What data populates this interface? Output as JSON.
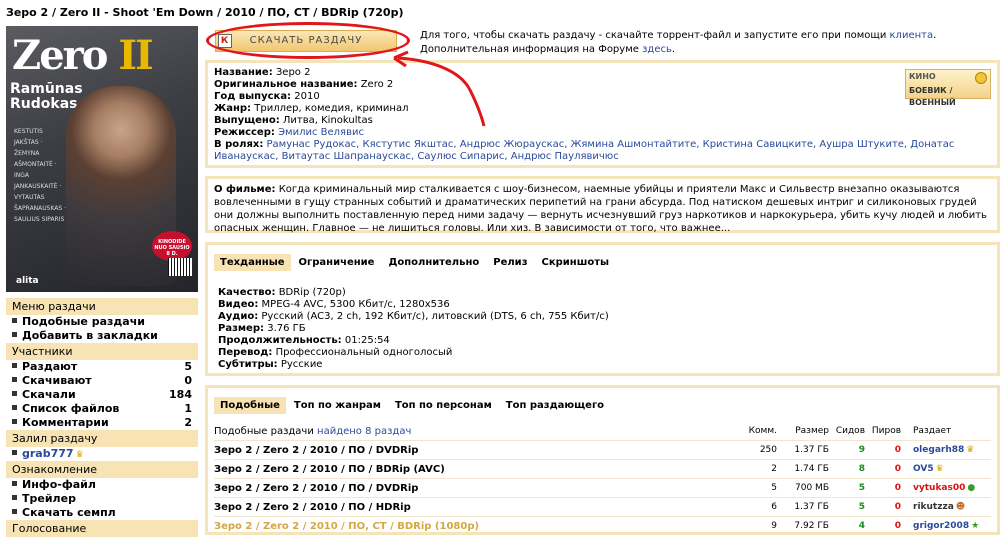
{
  "title": "Зеро 2 / Zero II - Shoot 'Em Down / 2010 / ПО, СТ / BDRip (720p)",
  "poster": {
    "logo_a": "Zero",
    "logo_b": "II",
    "actor1": "Ramūnas",
    "actor2": "Rudokas",
    "names": "KESTUTIS JAKŠTAS · ŽEMYNA AŠMONTAITĖ · INGA JANKAUSKAITĖ · VYTAUTAS ŠAPRANAUSKAS · SAULIUS SIPARIS",
    "badge": "KINODIDE NUO SAUSIO 8 D.",
    "studio": "alita"
  },
  "download": {
    "button": "СКАЧАТЬ РАЗДАЧУ",
    "text_a": "Для того, чтобы скачать раздачу - скачайте торрент-файл и запустите его при помощи",
    "client_link": "клиента",
    "text_b": ". Дополнительная информация на Форуме",
    "here_link": "здесь",
    "text_c": "."
  },
  "info": {
    "name_label": "Название:",
    "name": "Зеро 2",
    "orig_label": "Оригинальное название:",
    "orig": "Zero 2",
    "year_label": "Год выпуска:",
    "year": "2010",
    "genre_label": "Жанр:",
    "genre": "Триллер, комедия, криминал",
    "released_label": "Выпущено:",
    "released": "Литва, Kinokultas",
    "director_label": "Режиссер:",
    "director": "Эмилис Велявис",
    "cast_label": "В ролях:",
    "cast": "Рамунас Рудокас, Кястутис Якштас, Андрюс Жюраускас, Жямина Ашмонтайтите, Кристина Савицките, Аушра Штуките, Донатас Иванаускас, Витаутас Шапранаускас, Саулюс Сипарис, Андрюс Паулявичюс",
    "badge_top": "КИНО",
    "badge_genre": "БОЕВИК / ВОЕННЫЙ"
  },
  "about": {
    "label": "О фильме:",
    "text": "Когда криминальный мир сталкивается с шоу-бизнесом, наемные убийцы и приятели Макс и Сильвестр внезапно оказываются вовлеченными в гущу странных событий и драматических перипетий на грани абсурда. Под натиском дешевых интриг и силиконовых грудей они должны выполнить поставленную перед ними задачу — вернуть исчезнувший груз наркотиков и наркокурьера, убить кучу людей и любить опасных женщин. Главное — не лишиться головы. Или хиз. В зависимости от того, что важнее..."
  },
  "tabs": [
    "Техданные",
    "Ограничение",
    "Дополнительно",
    "Релиз",
    "Скриншоты"
  ],
  "tech": {
    "quality_label": "Качество:",
    "quality": "BDRip (720p)",
    "video_label": "Видео:",
    "video": "MPEG-4 AVC, 5300 Кбит/с, 1280x536",
    "audio_label": "Аудио:",
    "audio": "Русский (AC3, 2 ch, 192 Кбит/с), литовский (DTS, 6 ch, 755 Кбит/с)",
    "size_label": "Размер:",
    "size": "3.76 ГБ",
    "duration_label": "Продолжительность:",
    "duration": "01:25:54",
    "translation_label": "Перевод:",
    "translation": "Профессиональный одноголосый",
    "subs_label": "Субтитры:",
    "subs": "Русские"
  },
  "similar_tabs": [
    "Подобные",
    "Топ по жанрам",
    "Топ по персонам",
    "Топ раздающего"
  ],
  "similar": {
    "head_title": "Подобные раздачи",
    "found": "найдено 8 раздач",
    "col_comments": "Комм.",
    "col_size": "Размер",
    "col_seeds": "Сидов",
    "col_peers": "Пиров",
    "col_uploader": "Раздает",
    "rows": [
      {
        "title": "Зеро 2 / Zero 2 / 2010 / ПО / DVDRip",
        "comments": "250",
        "size": "1.37 ГБ",
        "seeds": "9",
        "peers": "0",
        "uploader": "olegarh88"
      },
      {
        "title": "Зеро 2 / Zero 2 / 2010 / ПО / BDRip (AVC)",
        "comments": "2",
        "size": "1.74 ГБ",
        "seeds": "8",
        "peers": "0",
        "uploader": "OV5"
      },
      {
        "title": "Зеро 2 / Zero 2 / 2010 / ПО / DVDRip",
        "comments": "5",
        "size": "700 МБ",
        "seeds": "5",
        "peers": "0",
        "uploader": "vytukas00"
      },
      {
        "title": "Зеро 2 / Zero 2 / 2010 / ПО / HDRip",
        "comments": "6",
        "size": "1.37 ГБ",
        "seeds": "5",
        "peers": "0",
        "uploader": "rikutzza"
      },
      {
        "title": "Зеро 2 / Zero 2 / 2010 / ПО, СТ / BDRip (1080p)",
        "comments": "9",
        "size": "7.92 ГБ",
        "seeds": "4",
        "peers": "0",
        "uploader": "grigor2008"
      }
    ]
  },
  "sidebar": {
    "menu_header": "Меню раздачи",
    "menu_items": [
      "Подобные раздачи",
      "Добавить в закладки"
    ],
    "participants_header": "Участники",
    "participants": [
      {
        "label": "Раздают",
        "count": "5"
      },
      {
        "label": "Скачивают",
        "count": "0"
      },
      {
        "label": "Скачали",
        "count": "184"
      },
      {
        "label": "Список файлов",
        "count": "1"
      },
      {
        "label": "Комментарии",
        "count": "2"
      }
    ],
    "uploaded_header": "Залил раздачу",
    "uploader": "grab777",
    "review_header": "Ознакомление",
    "review_items": [
      "Инфо-файл",
      "Трейлер",
      "Скачать семпл"
    ],
    "vote_header": "Голосование"
  }
}
